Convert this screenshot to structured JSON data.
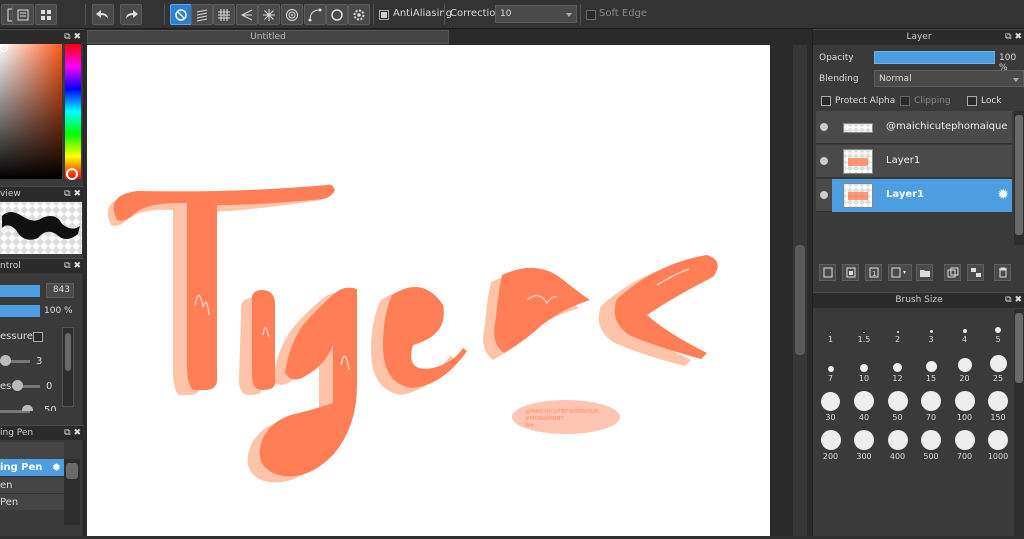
{
  "toolbar": {
    "antialiasing_label": "AntiAliasing",
    "correction_label": "Correction",
    "correction_value": "10",
    "soft_edge_label": "Soft Edge"
  },
  "left_panel": {
    "navigator_title": "view",
    "control_title": "ntrol",
    "brush_size_value": "843",
    "opacity_value": "100 %",
    "pressure_label": "essure",
    "slider1_value": "3",
    "slider2_label": "es",
    "slider2_value": "0",
    "slider3_value": "50",
    "brush_panel_title": "ing Pen",
    "brush_items": [
      "ing Pen",
      "en",
      "Pen"
    ]
  },
  "canvas": {
    "tab_title": "Untitled",
    "artwork_text": "Tye >e",
    "watermark_lines": [
      "@MAICHICUTEPHOMAIQUE",
      "#MOIRAPRINT",
      "Wit"
    ]
  },
  "layer_panel": {
    "title": "Layer",
    "opacity_label": "Opacity",
    "opacity_value": "100 %",
    "blending_label": "Blending",
    "blending_value": "Normal",
    "protect_alpha_label": "Protect Alpha",
    "clipping_label": "Clipping",
    "lock_label": "Lock",
    "layers": [
      {
        "name": "@maichicutephomaique",
        "selected": false
      },
      {
        "name": "Layer1",
        "selected": false
      },
      {
        "name": "Layer1",
        "selected": true
      }
    ]
  },
  "brush_size_panel": {
    "title": "Brush Size",
    "sizes": [
      "1",
      "1.5",
      "2",
      "3",
      "4",
      "5",
      "7",
      "10",
      "12",
      "15",
      "20",
      "25",
      "30",
      "40",
      "50",
      "70",
      "100",
      "150",
      "200",
      "300",
      "400",
      "500",
      "700",
      "1000"
    ]
  },
  "colors": {
    "accent": "#4d9ee0",
    "lettering": "#ff7e55",
    "lettering_shadow": "#ffc3a8"
  }
}
